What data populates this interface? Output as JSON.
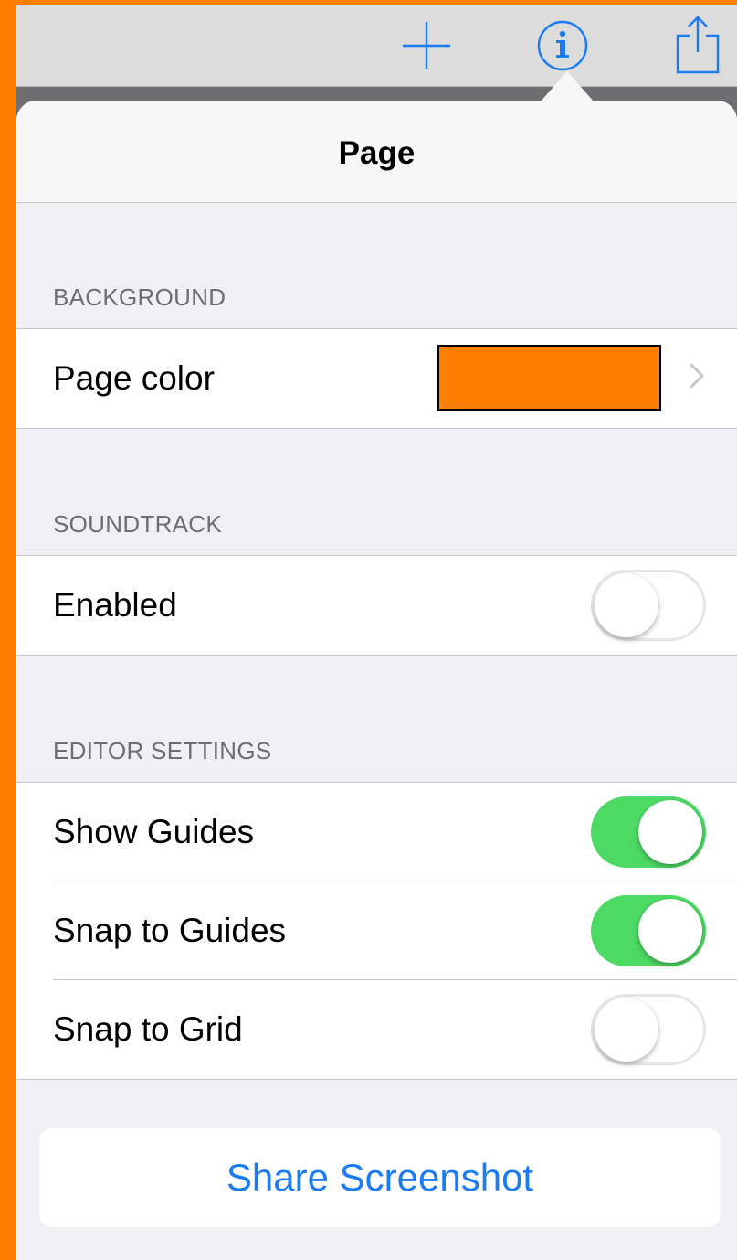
{
  "toolbar": {
    "icons": [
      "add-icon",
      "info-icon",
      "share-icon"
    ],
    "accent": "#1a7cf5"
  },
  "popover": {
    "title": "Page"
  },
  "sections": {
    "background": {
      "header": "BACKGROUND",
      "page_color_label": "Page color",
      "page_color_value": "#ff7f00"
    },
    "soundtrack": {
      "header": "SOUNDTRACK",
      "enabled_label": "Enabled",
      "enabled": false
    },
    "editor_settings": {
      "header": "EDITOR SETTINGS",
      "rows": [
        {
          "label": "Show Guides",
          "on": true
        },
        {
          "label": "Snap to Guides",
          "on": true
        },
        {
          "label": "Snap to Grid",
          "on": false
        }
      ]
    }
  },
  "share_button": {
    "label": "Share Screenshot"
  },
  "colors": {
    "toggle_on": "#4cd964",
    "page_background": "#ff7f00"
  }
}
